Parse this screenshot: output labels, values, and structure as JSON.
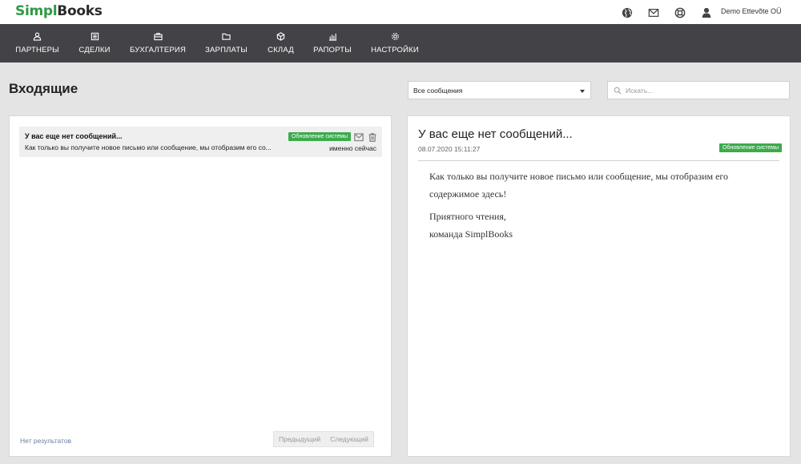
{
  "header": {
    "logo_part1": "Simpl",
    "logo_part2": "Books",
    "company": "Demo Ettevõte OÜ",
    "icons": [
      "globe-icon",
      "mail-icon",
      "lifebuoy-icon",
      "user-icon"
    ]
  },
  "nav": {
    "items": [
      {
        "label": "ПАРТНЕРЫ",
        "icon": "partners-icon"
      },
      {
        "label": "СДЕЛКИ",
        "icon": "deals-icon"
      },
      {
        "label": "БУХГАЛТЕРИЯ",
        "icon": "accounting-icon"
      },
      {
        "label": "ЗАРПЛАТЫ",
        "icon": "folder-icon"
      },
      {
        "label": "СКЛАД",
        "icon": "warehouse-icon"
      },
      {
        "label": "РАПОРТЫ",
        "icon": "reports-icon"
      },
      {
        "label": "НАСТРОЙКИ",
        "icon": "settings-icon"
      }
    ]
  },
  "page": {
    "title": "Входящие",
    "filter_selected": "Все сообщения",
    "search_placeholder": "Искать..."
  },
  "inbox": {
    "messages": [
      {
        "subject": "У вас еще нет сообщений...",
        "preview": "Как только вы получите новое письмо или сообщение, мы отобразим его со...",
        "badge": "Обновление системы",
        "time": "именно сейчас"
      }
    ],
    "no_results": "Нет результатов",
    "prev_label": "Предыдущий",
    "next_label": "Следующий"
  },
  "detail": {
    "title": "У вас еще нет сообщений...",
    "date": "08.07.2020 15:11:27",
    "badge": "Обновление системы",
    "body_line1": "Как только вы получите новое письмо или сообщение, мы отобразим его содержимое здесь!",
    "body_line2": "Приятного чтения,",
    "body_line3": "команда SimplBooks"
  },
  "colors": {
    "brand_green": "#2e9a45",
    "nav_bg": "#434347",
    "badge_green": "#3daa4e",
    "page_bg": "#e4e4e4"
  }
}
